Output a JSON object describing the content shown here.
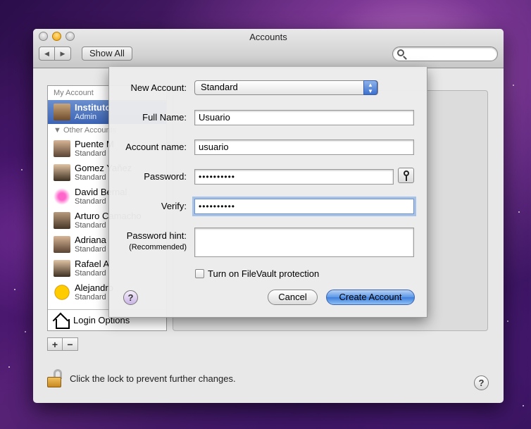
{
  "window": {
    "title": "Accounts"
  },
  "toolbar": {
    "show_all_label": "Show All",
    "search_placeholder": ""
  },
  "sidebar": {
    "my_account_header": "My Account",
    "selected_user": {
      "name": "Instituto",
      "role": "Admin"
    },
    "other_accounts_header": "Other Accounts",
    "users": [
      {
        "name": "Puente M",
        "role": "Standard",
        "avatar": "person-photo"
      },
      {
        "name": "Gomez Yañez",
        "role": "Standard",
        "avatar": "person-photo"
      },
      {
        "name": "David Bernal",
        "role": "Standard",
        "avatar": "lips-icon"
      },
      {
        "name": "Arturo Camacho",
        "role": "Standard",
        "avatar": "person-photo"
      },
      {
        "name": "Adriana",
        "role": "Standard",
        "avatar": "person-photo"
      },
      {
        "name": "Rafael A",
        "role": "Standard",
        "avatar": "person-photo"
      },
      {
        "name": "Alejandro",
        "role": "Standard",
        "avatar": "tennis-ball-icon"
      }
    ],
    "login_options_label": "Login Options"
  },
  "footer": {
    "lock_text": "Click the lock to prevent further changes."
  },
  "sheet": {
    "new_account_label": "New Account:",
    "new_account_value": "Standard",
    "full_name_label": "Full Name:",
    "full_name_value": "Usuario",
    "account_name_label": "Account name:",
    "account_name_value": "usuario",
    "password_label": "Password:",
    "password_value": "••••••••••",
    "verify_label": "Verify:",
    "verify_value": "••••••••••",
    "hint_label": "Password hint:",
    "hint_sub_label": "(Recommended)",
    "hint_value": "",
    "filevault_label": "Turn on FileVault protection",
    "cancel_label": "Cancel",
    "create_label": "Create Account"
  },
  "colors": {
    "selection": "#3c64b5",
    "default_button": "#3f7fdc",
    "focus_ring": "#6b93d6"
  }
}
